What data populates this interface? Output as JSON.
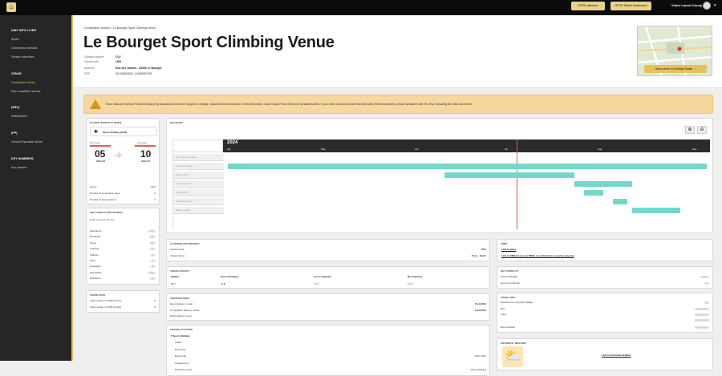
{
  "topbar": {
    "btn1": "OPOF planneur",
    "btn2": "OPOF Studio Dashboard",
    "user": "Victor Lauret-Couvy"
  },
  "sidebar": {
    "sections": [
      {
        "head": "UNIT INFO LIVER",
        "items": [
          "Sports",
          "Competition schedule",
          "Session schedules"
        ]
      },
      {
        "head": "VENUE",
        "items": [
          "Competition venues",
          "Non competition venues"
        ]
      },
      {
        "head": "(SRC)",
        "items": [
          "Stakeholders"
        ]
      },
      {
        "head": "(PP)",
        "items": [
          "Venues Population Model"
        ]
      },
      {
        "head": "KEY NUMBERS",
        "items": [
          "Key numbers"
        ]
      }
    ],
    "active": "Competition venues"
  },
  "header": {
    "breadcrumb": "Competition venues  >  Le Bourget Sport Climbing Venue",
    "title": "Le Bourget Sport Climbing Venue",
    "meta": [
      {
        "k": "Cluster/Location",
        "v": "CLV"
      },
      {
        "k": "Venue code",
        "v": "LBO"
      },
      {
        "k": "Address",
        "v": "Rue des Jardins - 93350 Le Bourget"
      },
      {
        "k": "GPS",
        "v": "48.935604523, 2.4349987705"
      }
    ],
    "map_button": "Open venue in OneMap Studio"
  },
  "warning": "These data are internal Paris2024 planning assumptions that are subject to change. Unauthorized disclosure of this information could impact Paris 2024 and its stakeholders. If you need to share certain elements with external partners, please validate it with IRL first, indicating the data concerned.",
  "sports_card": {
    "label": "Olympic sports at venue",
    "sport": "Sport climbing (CLB)",
    "first_label": "First date",
    "first_day": "05",
    "first_mon": "AUG 24",
    "last_label": "Last date",
    "last_day": "10",
    "last_mon": "AUG 24",
    "rows": [
      {
        "k": "Venue",
        "v": "LBO"
      },
      {
        "k": "Number of competition days",
        "v": "6"
      },
      {
        "k": "Number of total sessions",
        "v": "6"
      }
    ]
  },
  "gantt": {
    "label": "Key dates",
    "year": "2024",
    "months": [
      "Apr",
      "May",
      "Jun",
      "Jul",
      "Aug",
      "Sep"
    ],
    "rows": [
      "Non exclusive period",
      "Exclusive period",
      "Bump-in OLY",
      "Look ahead OLY",
      "Training OLY",
      "Competition OLY",
      "Bump-out OLY"
    ],
    "bars": [
      {
        "row": 1,
        "start": 0.0,
        "end": 0.995
      },
      {
        "row": 2,
        "start": 0.45,
        "end": 0.72
      },
      {
        "row": 3,
        "start": 0.72,
        "end": 0.84
      },
      {
        "row": 4,
        "start": 0.74,
        "end": 0.78
      },
      {
        "row": 5,
        "start": 0.8,
        "end": 0.83
      },
      {
        "row": 6,
        "start": 0.84,
        "end": 0.94
      }
    ],
    "today": 0.6
  },
  "pnc_card": {
    "label": "PNC capacity per session",
    "rows": [
      [
        "Spectators",
        "7000"
      ],
      [
        "Broadcast",
        "450"
      ],
      [
        "Press",
        "200"
      ],
      [
        "Catering",
        "750"
      ],
      [
        "Athletes",
        "68"
      ],
      [
        "Team",
        "10"
      ],
      [
        "Hospitality",
        "38"
      ],
      [
        "Specialists",
        "1200"
      ],
      [
        "Workforce",
        "120"
      ]
    ],
    "sub": "Peak sessions per day"
  },
  "venue_stats": {
    "label": "Venue stats",
    "rows": [
      [
        "Total number of FOB (blocks)",
        "0"
      ],
      [
        "Total number of VOB (blocks)",
        "0"
      ]
    ]
  },
  "cluster": {
    "label": "Clusters and precinct",
    "rows": [
      [
        "Cluster Code",
        "PRC"
      ],
      [
        "Cluster Name",
        "Paris - North"
      ]
    ]
  },
  "capacity": {
    "label": "Venue capacity",
    "headers": [
      "Edition",
      "Sport discipline",
      "Gross Capacity",
      "Net Capacity"
    ],
    "row": [
      "OLY",
      "CLB",
      "7000",
      "6000"
    ]
  },
  "delivery": {
    "label": "Venue delivery",
    "rows": [
      [
        "Event delivery model",
        "Paris2024"
      ],
      [
        "Competition delivery model",
        "Paris2024"
      ],
      [
        "Entity delivery name",
        ""
      ]
    ]
  },
  "events": {
    "label": "Testing activities",
    "sport": "Sport climbing",
    "rows": [
      [
        "Status",
        ""
      ],
      [
        "Event title",
        ""
      ],
      [
        "Event type",
        "Paris 2024"
      ],
      [
        "Organised by",
        ""
      ],
      [
        "Discipline name",
        "Sport climbing"
      ]
    ]
  },
  "links": {
    "label": "Links",
    "l1": "Link to plans",
    "l2": "Link to DRB (Access to DRBs is restricted for security reasons)"
  },
  "contacts": {
    "label": "Key contacts",
    "rows": [
      [
        "Sports Manager",
        ""
      ],
      [
        "Event Coordinator",
        ""
      ]
    ]
  },
  "travel": {
    "label": "Travel info",
    "rows": [
      [
        "Distance from Olympic Village",
        ""
      ],
      [
        "Bus",
        ""
      ],
      [
        "Train",
        ""
      ],
      [
        "",
        ""
      ],
      [
        "Bus schedule",
        ""
      ]
    ]
  },
  "weather": {
    "label": "Historical weather",
    "link": "Link to historical weather"
  }
}
